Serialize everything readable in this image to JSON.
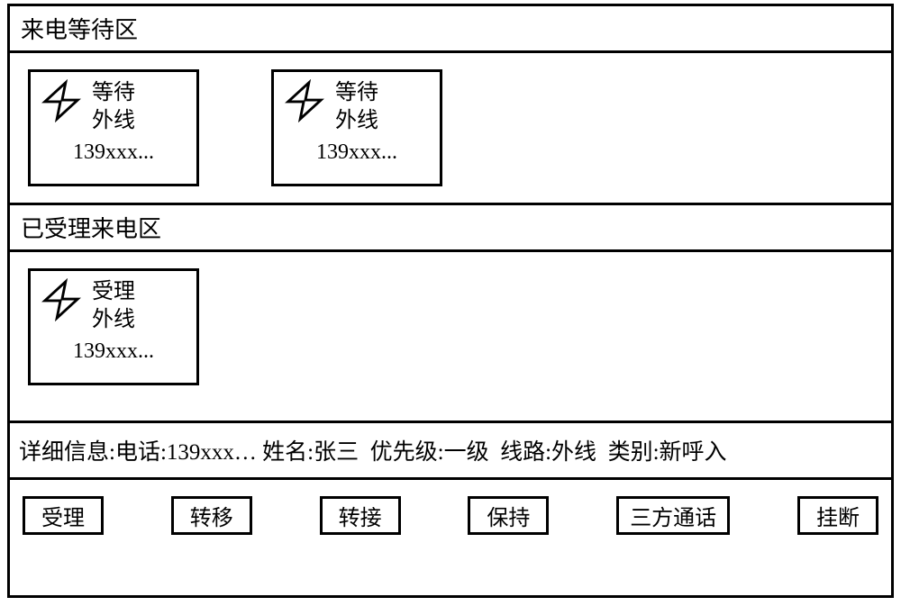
{
  "waiting_area": {
    "title": "来电等待区",
    "cards": [
      {
        "status": "等待",
        "line": "外线",
        "number": "139xxx..."
      },
      {
        "status": "等待",
        "line": "外线",
        "number": "139xxx..."
      }
    ]
  },
  "accepted_area": {
    "title": "已受理来电区",
    "cards": [
      {
        "status": "受理",
        "line": "外线",
        "number": "139xxx..."
      }
    ]
  },
  "details": {
    "prefix": "详细信息:",
    "phone_label": "电话:",
    "phone_value": "139xxx…",
    "name_label": "姓名:",
    "name_value": "张三",
    "priority_label": "优先级:",
    "priority_value": "一级",
    "line_label": "线路:",
    "line_value": "外线",
    "category_label": "类别:",
    "category_value": "新呼入"
  },
  "buttons": {
    "accept": "受理",
    "transfer": "转移",
    "forward": "转接",
    "hold": "保持",
    "conference": "三方通话",
    "hangup": "挂断"
  },
  "icons": {
    "lightning": "lightning-icon"
  }
}
